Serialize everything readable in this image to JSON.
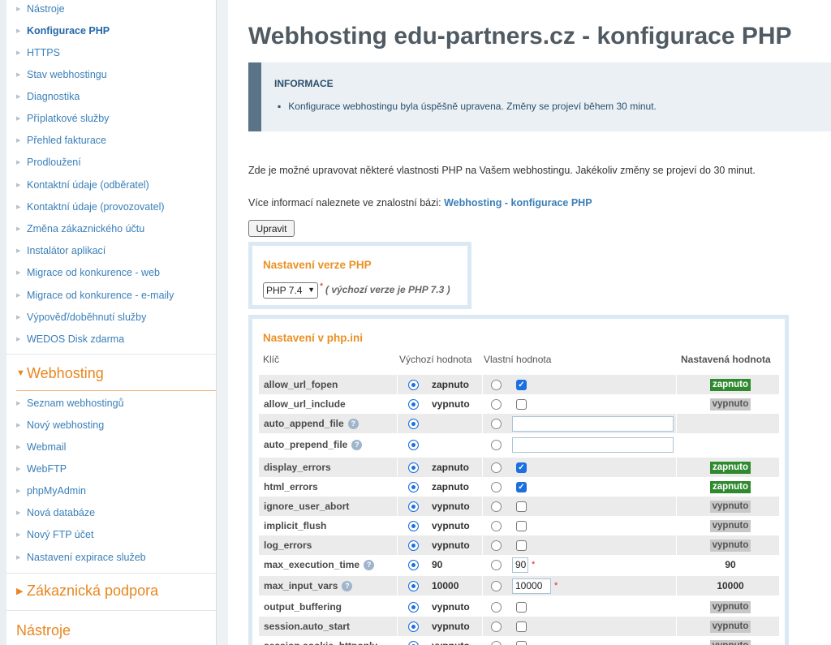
{
  "sidebar": {
    "top_items": [
      {
        "label": "Nástroje"
      },
      {
        "label": "Konfigurace PHP"
      },
      {
        "label": "HTTPS"
      },
      {
        "label": "Stav webhostingu"
      },
      {
        "label": "Diagnostika"
      },
      {
        "label": "Příplatkové služby"
      },
      {
        "label": "Přehled fakturace"
      },
      {
        "label": "Prodloužení"
      },
      {
        "label": "Kontaktní údaje (odběratel)"
      },
      {
        "label": "Kontaktní údaje (provozovatel)"
      },
      {
        "label": "Změna zákaznického účtu"
      },
      {
        "label": "Instalátor aplikací"
      },
      {
        "label": "Migrace od konkurence - web"
      },
      {
        "label": "Migrace od konkurence - e-maily"
      },
      {
        "label": "Výpověď/doběhnutí služby"
      },
      {
        "label": "WEDOS Disk zdarma"
      }
    ],
    "webhosting_section": {
      "title": "Webhosting",
      "items": [
        {
          "label": "Seznam webhostingů"
        },
        {
          "label": "Nový webhosting"
        },
        {
          "label": "Webmail"
        },
        {
          "label": "WebFTP"
        },
        {
          "label": "phpMyAdmin"
        },
        {
          "label": "Nová databáze"
        },
        {
          "label": "Nový FTP účet"
        },
        {
          "label": "Nastavení expirace služeb"
        }
      ]
    },
    "support_section": {
      "title": "Zákaznická podpora"
    },
    "tools_section": {
      "title": "Nástroje"
    }
  },
  "main": {
    "title": "Webhosting edu-partners.cz - konfigurace PHP",
    "info": {
      "title": "INFORMACE",
      "message": "Konfigurace webhostingu byla úspěšně upravena. Změny se projeví během 30 minut."
    },
    "intro": "Zde je možné upravovat některé vlastnosti PHP na Vašem webhostingu. Jakékoliv změny se projeví do 30 minut.",
    "kb_prefix": "Více informací naleznete ve znalostní bázi: ",
    "kb_link": "Webhosting - konfigurace PHP",
    "edit_button": "Upravit",
    "version_panel": {
      "title": "Nastavení verze PHP",
      "selected": "PHP 7.4",
      "required_mark": "*",
      "default_note": "( výchozí verze je  PHP 7.3 )"
    },
    "ini_panel": {
      "title": "Nastavení v php.ini",
      "columns": {
        "key": "Klíč",
        "default": "Výchozí hodnota",
        "custom": "Vlastní hodnota",
        "set": "Nastavená hodnota"
      },
      "rows": [
        {
          "key": "allow_url_fopen",
          "type": "bool",
          "default": "zapnuto",
          "custom_checked": true,
          "set": "zapnuto",
          "help": false
        },
        {
          "key": "allow_url_include",
          "type": "bool",
          "default": "vypnuto",
          "custom_checked": false,
          "set": "vypnuto",
          "help": false
        },
        {
          "key": "auto_append_file",
          "type": "text",
          "default": "",
          "custom_value": "",
          "set": "",
          "help": true
        },
        {
          "key": "auto_prepend_file",
          "type": "text",
          "default": "",
          "custom_value": "",
          "set": "",
          "help": true
        },
        {
          "key": "display_errors",
          "type": "bool",
          "default": "zapnuto",
          "custom_checked": true,
          "set": "zapnuto",
          "help": false
        },
        {
          "key": "html_errors",
          "type": "bool",
          "default": "zapnuto",
          "custom_checked": true,
          "set": "zapnuto",
          "help": false
        },
        {
          "key": "ignore_user_abort",
          "type": "bool",
          "default": "vypnuto",
          "custom_checked": false,
          "set": "vypnuto",
          "help": false
        },
        {
          "key": "implicit_flush",
          "type": "bool",
          "default": "vypnuto",
          "custom_checked": false,
          "set": "vypnuto",
          "help": false
        },
        {
          "key": "log_errors",
          "type": "bool",
          "default": "vypnuto",
          "custom_checked": false,
          "set": "vypnuto",
          "help": false
        },
        {
          "key": "max_execution_time",
          "type": "num",
          "default": "90",
          "custom_value": "90",
          "set": "90",
          "help": true
        },
        {
          "key": "max_input_vars",
          "type": "num",
          "default": "10000",
          "custom_value": "10000",
          "set": "10000",
          "help": true
        },
        {
          "key": "output_buffering",
          "type": "bool",
          "default": "vypnuto",
          "custom_checked": false,
          "set": "vypnuto",
          "help": false
        },
        {
          "key": "session.auto_start",
          "type": "bool",
          "default": "vypnuto",
          "custom_checked": false,
          "set": "vypnuto",
          "help": false
        },
        {
          "key": "session.cookie_httponly",
          "type": "bool",
          "default": "vypnuto",
          "custom_checked": false,
          "set": "vypnuto",
          "help": false
        }
      ]
    }
  },
  "colors": {
    "accent_orange": "#e8861e",
    "link_blue": "#3a7fb8",
    "badge_on": "#2f8a2f",
    "badge_off": "#c8c8c8"
  }
}
